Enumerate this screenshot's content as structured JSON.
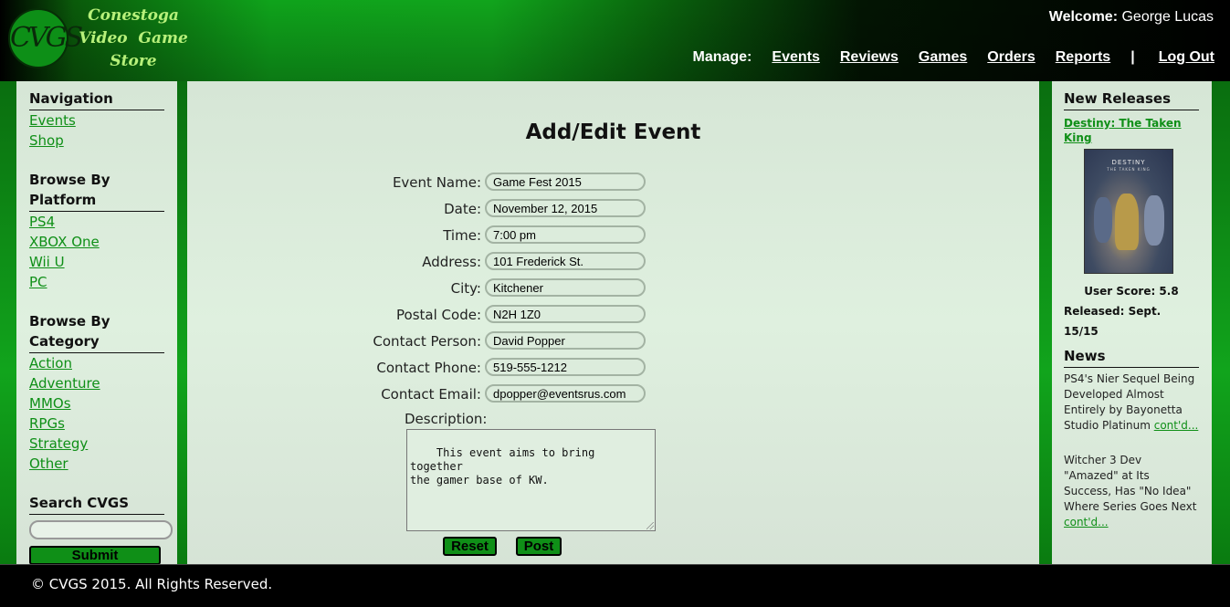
{
  "header": {
    "logo_initials": "CVGS",
    "logo_lines": [
      "Conestoga",
      "Video  Game",
      "Store"
    ],
    "welcome_label": "Welcome:",
    "welcome_user": "George Lucas",
    "manage_label": "Manage:",
    "nav": [
      "Events",
      "Reviews",
      "Games",
      "Orders",
      "Reports"
    ],
    "separator": "|",
    "logout": "Log Out"
  },
  "left": {
    "navigation_heading": "Navigation",
    "navigation_links": [
      "Events",
      "Shop"
    ],
    "platform_heading": "Browse By Platform",
    "platform_links": [
      "PS4",
      "XBOX One",
      "Wii U",
      "PC"
    ],
    "category_heading": "Browse By Category",
    "category_links": [
      "Action",
      "Adventure",
      "MMOs",
      "RPGs",
      "Strategy",
      "Other"
    ],
    "search_heading": "Search CVGS",
    "search_value": "",
    "search_button": "Submit"
  },
  "form": {
    "title": "Add/Edit Event",
    "fields": [
      {
        "label": "Event Name:",
        "value": "Game Fest 2015"
      },
      {
        "label": "Date:",
        "value": "November 12, 2015"
      },
      {
        "label": "Time:",
        "value": "7:00 pm"
      },
      {
        "label": "Address:",
        "value": "101 Frederick St."
      },
      {
        "label": "City:",
        "value": "Kitchener"
      },
      {
        "label": "Postal Code:",
        "value": "N2H 1Z0"
      },
      {
        "label": "Contact Person:",
        "value": "David Popper"
      },
      {
        "label": "Contact Phone:",
        "value": "519-555-1212"
      },
      {
        "label": "Contact Email:",
        "value": "dpopper@eventsrus.com"
      }
    ],
    "description_label": "Description:",
    "description_value": "This event aims to bring together\nthe gamer base of KW.",
    "reset_button": "Reset",
    "post_button": "Post"
  },
  "right": {
    "new_releases_heading": "New Releases",
    "release_title": "Destiny: The Taken King",
    "cover_title": "DESTINY",
    "cover_subtitle": "THE TAKEN KING",
    "user_score": "User Score: 5.8",
    "released": "Released: Sept. 15/15",
    "news_heading": "News",
    "news": [
      {
        "text": "PS4's Nier Sequel Being Developed Almost Entirely by Bayonetta Studio Platinum ",
        "link": "cont'd..."
      },
      {
        "text": "Witcher 3 Dev \"Amazed\" at Its Success, Has \"No Idea\" Where Series Goes Next ",
        "link": "cont'd..."
      }
    ]
  },
  "footer": {
    "text": "© CVGS 2015. All Rights Reserved."
  },
  "colors": {
    "accent_green": "#0f8f17",
    "panel_bg": "#dfefdf",
    "logo_text": "#b7f07a"
  }
}
